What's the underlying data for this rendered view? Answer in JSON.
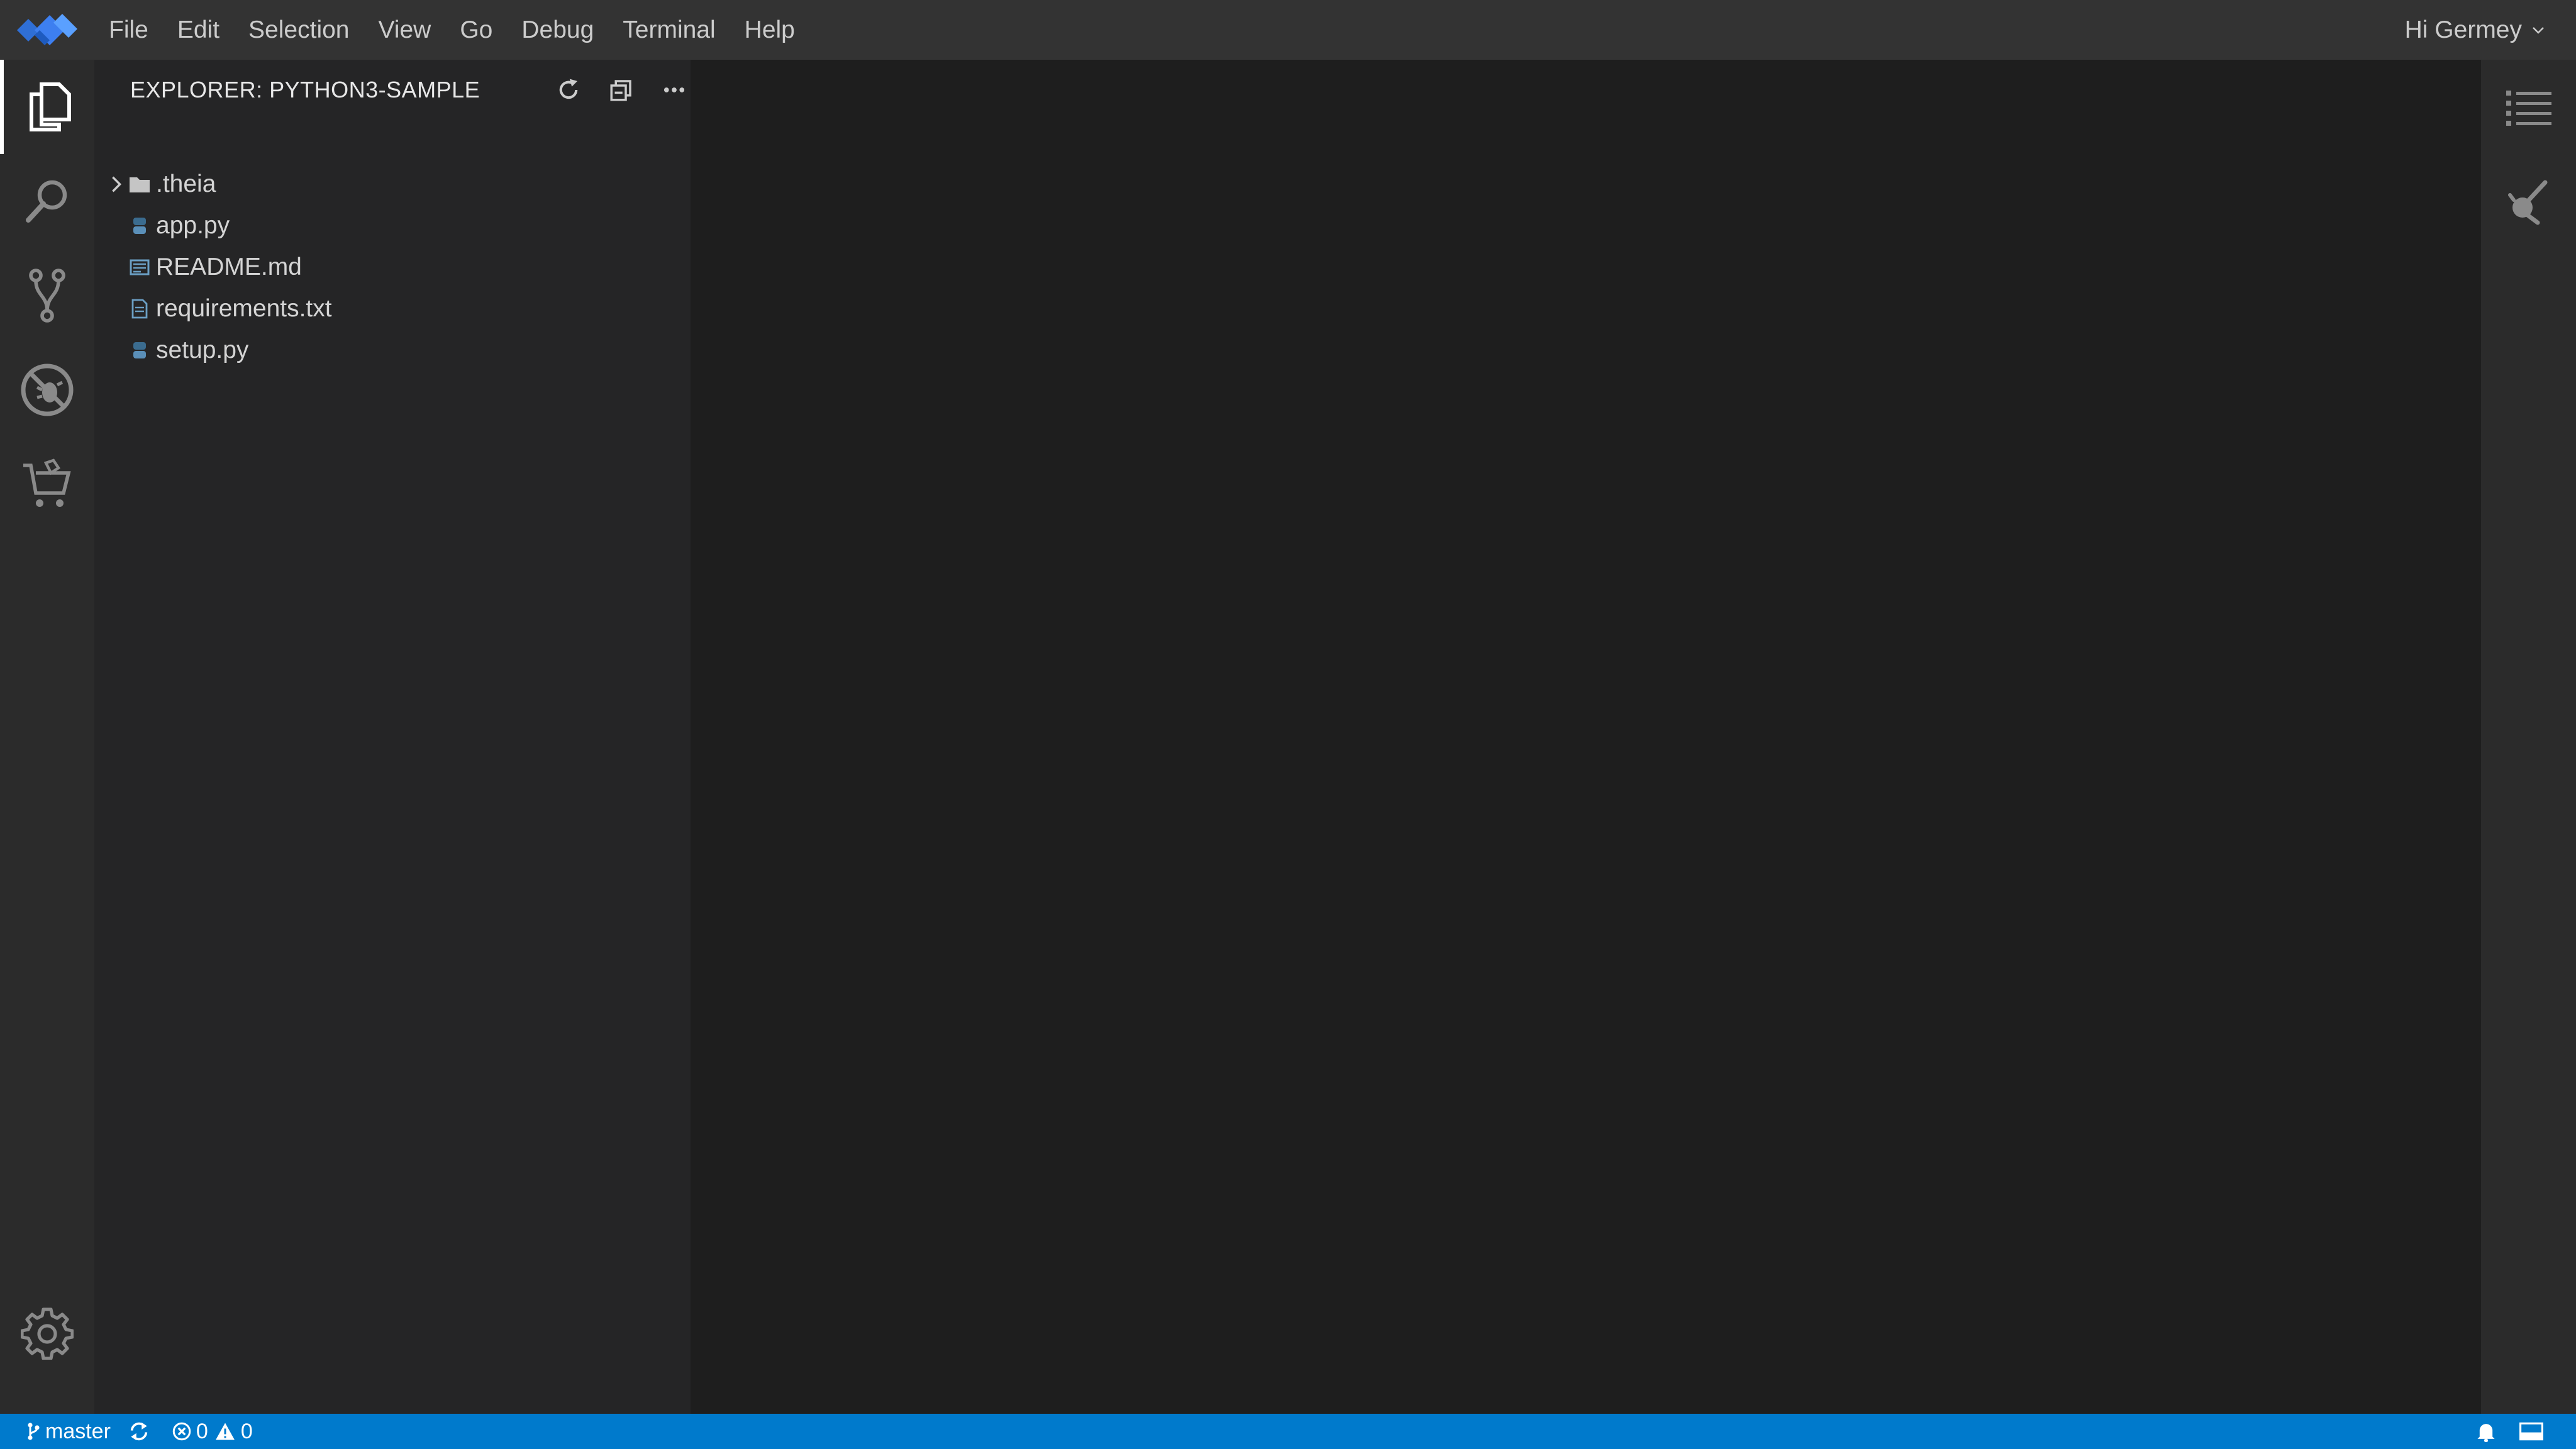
{
  "menubar": {
    "items": [
      "File",
      "Edit",
      "Selection",
      "View",
      "Go",
      "Debug",
      "Terminal",
      "Help"
    ],
    "user_label": "Hi Germey"
  },
  "activitybar": {
    "items": [
      {
        "name": "explorer",
        "icon": "files-icon",
        "active": true
      },
      {
        "name": "search",
        "icon": "search-icon",
        "active": false
      },
      {
        "name": "source-control",
        "icon": "source-control-icon",
        "active": false
      },
      {
        "name": "debug",
        "icon": "debug-icon",
        "active": false
      },
      {
        "name": "extensions",
        "icon": "extensions-icon",
        "active": false
      }
    ],
    "bottom_icon": "settings-gear-icon"
  },
  "explorer": {
    "title": "EXPLORER: PYTHON3-SAMPLE",
    "actions": [
      "refresh-icon",
      "collapse-all-icon",
      "more-actions-icon"
    ],
    "tree": [
      {
        "label": ".theia",
        "type": "folder",
        "icon": "folder-icon"
      },
      {
        "label": "app.py",
        "type": "file",
        "icon": "python-file-icon"
      },
      {
        "label": "README.md",
        "type": "file",
        "icon": "markdown-file-icon"
      },
      {
        "label": "requirements.txt",
        "type": "file",
        "icon": "text-file-icon"
      },
      {
        "label": "setup.py",
        "type": "file",
        "icon": "python-file-icon"
      }
    ]
  },
  "rightbar": {
    "items": [
      "outline-icon",
      "plugin-icon"
    ]
  },
  "statusbar": {
    "branch": "master",
    "errors": "0",
    "warnings": "0"
  },
  "colors": {
    "accent": "#007acc",
    "logo_blue": "#2f6fd6",
    "logo_light": "#5aa0ff"
  }
}
